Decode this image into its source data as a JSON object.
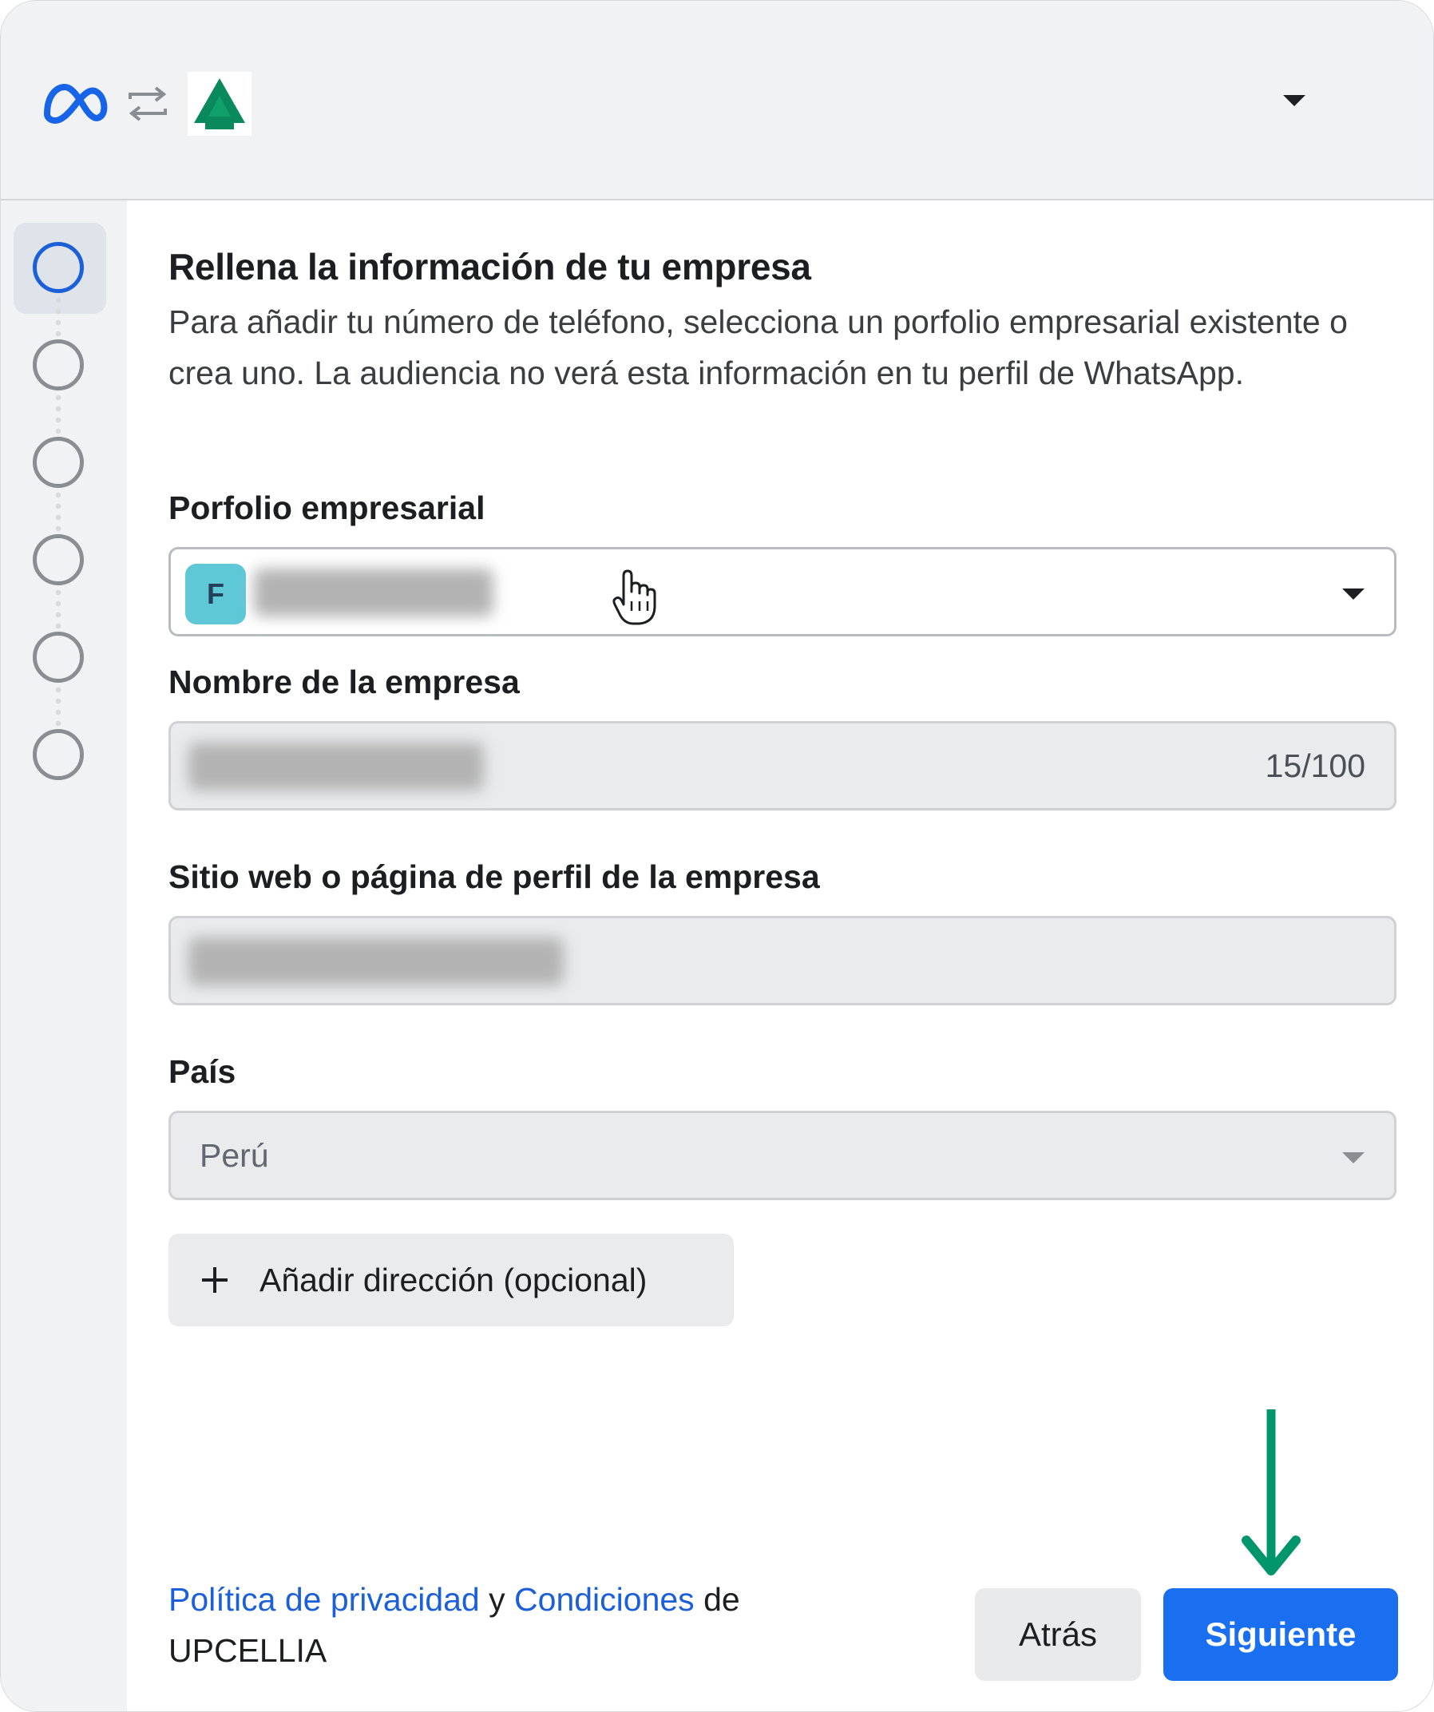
{
  "colors": {
    "accent": "#1a6ff0",
    "link": "#1b5fd9",
    "arrow": "#00956a",
    "brand_green": "#0a8a5c",
    "badge": "#5ec8d6"
  },
  "header": {
    "icons": [
      "meta-logo-icon",
      "swap-arrows-icon",
      "brand-logo-icon",
      "caret-down-icon"
    ]
  },
  "stepper": {
    "steps": 6,
    "active_index": 0
  },
  "form": {
    "title": "Rellena la información de tu empresa",
    "description": "Para añadir tu número de teléfono, selecciona un porfolio empresarial existente o crea uno. La audiencia no verá esta información en tu perfil de WhatsApp.",
    "portfolio": {
      "label": "Porfolio empresarial",
      "badge_letter": "F"
    },
    "company_name": {
      "label": "Nombre de la empresa",
      "counter": "15/100"
    },
    "website": {
      "label": "Sitio web o página de perfil de la empresa"
    },
    "country": {
      "label": "País",
      "value": "Perú"
    },
    "add_address_label": "Añadir dirección (opcional)"
  },
  "footer": {
    "privacy_link": "Política de privacidad",
    "connector": " y ",
    "terms_link": "Condiciones",
    "suffix": " de",
    "company": "UPCELLIA",
    "back_label": "Atrás",
    "next_label": "Siguiente"
  }
}
